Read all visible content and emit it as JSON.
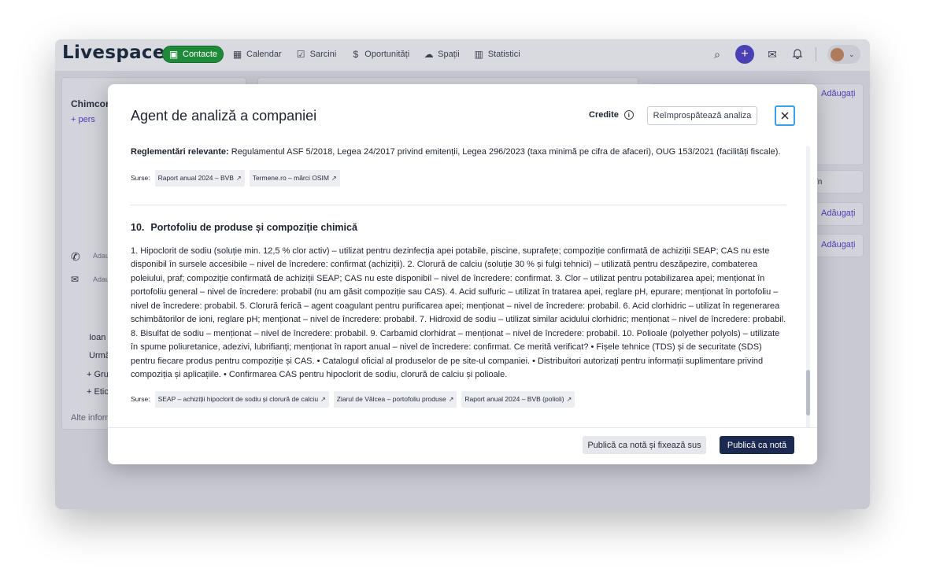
{
  "app": {
    "logo": "Livespace",
    "nav": [
      {
        "label": "Contacte",
        "icon": "▣"
      },
      {
        "label": "Calendar",
        "icon": "▦"
      },
      {
        "label": "Sarcini",
        "icon": "☑"
      },
      {
        "label": "Oportunități",
        "icon": "$"
      },
      {
        "label": "Spații",
        "icon": "☁"
      },
      {
        "label": "Statistici",
        "icon": "▥"
      }
    ],
    "icons": {
      "search": "⌕",
      "plus": "+",
      "mail": "✉",
      "bell": "🔔",
      "chevron": "⌄"
    }
  },
  "background": {
    "company_name": "Chimcomp",
    "add_person": "+ pers",
    "phone_placeholder": "Adau",
    "email_placeholder": "Adau",
    "owner": "Ioan I",
    "follow": "Urmă",
    "groups": "+ Grup",
    "tags": "+ Etich",
    "other_info": "Alte inform",
    "add_label": "Adăugați",
    "in_label": "în"
  },
  "modal": {
    "title": "Agent de analiză a companiei",
    "credits": "Credite",
    "refresh": "Reîmprospătează analiza",
    "reg_label": "Reglementări relevante:",
    "reg_text": "Regulamentul ASF 5/2018, Legea 24/2017 privind emitenții, Legea 296/2023 (taxa minimă pe cifra de afaceri), OUG 153/2021 (facilități fiscale).",
    "sources_label": "Surse:",
    "sources_1": [
      "Raport anual 2024 – BVB",
      "Termene.ro – mărci OSIM"
    ],
    "section_number": "10.",
    "section_title": "Portofoliu de produse și compoziție chimică",
    "section_text": "1. Hipoclorit de sodiu (soluție min. 12,5 % clor activ) – utilizat pentru dezinfecția apei potabile, piscine, suprafețe; compoziție confirmată de achiziții SEAP; CAS nu este disponibil în sursele accesibile – nivel de încredere: confirmat (achiziții). 2. Clorură de calciu (soluție 30 % și fulgi tehnici) – utilizată pentru deszăpezire, combaterea poleiului, praf; compoziție confirmată de achiziții SEAP; CAS nu este disponibil – nivel de încredere: confirmat. 3. Clor – utilizat pentru potabilizarea apei; menționat în portofoliu general – nivel de încredere: probabil (nu am găsit compoziție sau CAS). 4. Acid sulfuric – utilizat în tratarea apei, reglare pH, epurare; menționat în portofoliu – nivel de încredere: probabil. 5. Clorură ferică – agent coagulant pentru purificarea apei; menționat – nivel de încredere: probabil. 6. Acid clorhidric – utilizat în regenerarea schimbătorilor de ioni, reglare pH; menționat – nivel de încredere: probabil. 7. Hidroxid de sodiu – utilizat similar acidului clorhidric; menționat – nivel de încredere: probabil. 8. Bisulfat de sodiu – menționat – nivel de încredere: probabil. 9. Carbamid clorhidrat – menționat – nivel de încredere: probabil. 10. Polioale (polyether polyols) – utilizate în spume poliuretanice, adezivi, lubrifianți; menționat în raport anual – nivel de încredere: confirmat. Ce merită verificat? • Fișele tehnice (TDS) și de securitate (SDS) pentru fiecare produs pentru compoziție și CAS. • Catalogul oficial al produselor de pe site-ul companiei. • Distribuitori autorizați pentru informații suplimentare privind compoziția și aplicațiile. • Confirmarea CAS pentru hipoclorit de sodiu, clorură de calciu și polioale.",
    "sources_2": [
      "SEAP – achiziții hipoclorit de sodiu și clorură de calciu",
      "Ziarul de Vâlcea – portofoliu produse",
      "Raport anual 2024 – BVB (polioli)"
    ],
    "btn_pin": "Publică ca notă și fixează sus",
    "btn_publish": "Publică ca notă"
  }
}
